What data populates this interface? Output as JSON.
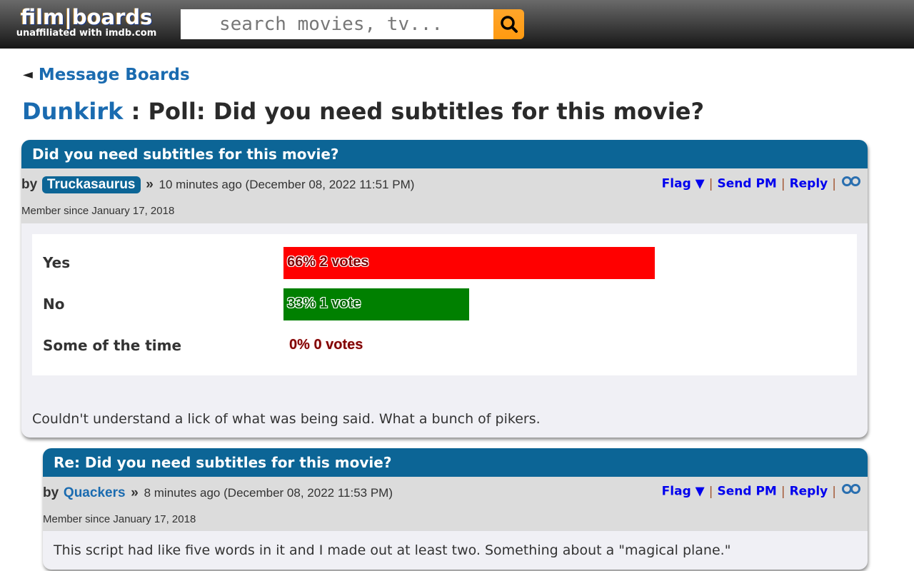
{
  "header": {
    "logo_main": "film|boards",
    "logo_sub": "unaffiliated with imdb.com",
    "search_placeholder": "search movies, tv...",
    "search_icon": "magnifier-icon",
    "accent_color": "#ff9f1c"
  },
  "breadcrumb": {
    "arrow": "◄",
    "label": "Message Boards"
  },
  "page_title": {
    "board": "Dunkirk",
    "separator": " : ",
    "topic": "Poll: Did you need subtitles for this movie?"
  },
  "posts": [
    {
      "title": "Did you need subtitles for this movie?",
      "by": "by",
      "author": "Truckasaurus",
      "raquo": "»",
      "time_ago": "10 minutes ago",
      "timestamp": "(December 08, 2022 11:51 PM)",
      "member_since": "Member since January 17, 2018",
      "actions": {
        "flag": "Flag ▼",
        "send_pm": "Send PM",
        "reply": "Reply",
        "sep": "|"
      },
      "poll": {
        "options": [
          {
            "label": "Yes",
            "percent": 66,
            "votes_text": "66% 2 votes",
            "color": "#ff0000"
          },
          {
            "label": "No",
            "percent": 33,
            "votes_text": "33% 1 vote",
            "color": "#008000"
          },
          {
            "label": "Some of the time",
            "percent": 0,
            "votes_text": "0% 0 votes",
            "color": "#800000"
          }
        ]
      },
      "body": "Couldn't understand a lick of what was being said. What a bunch of pikers."
    },
    {
      "title": "Re: Did you need subtitles for this movie?",
      "by": "by",
      "author": "Quackers",
      "raquo": "»",
      "time_ago": "8 minutes ago",
      "timestamp": "(December 08, 2022 11:53 PM)",
      "member_since": "Member since January 17, 2018",
      "actions": {
        "flag": "Flag ▼",
        "send_pm": "Send PM",
        "reply": "Reply",
        "sep": "|"
      },
      "body": "This script had like five words in it and I made out at least two. Something about a \"magical plane.\""
    }
  ],
  "colors": {
    "post_header": "#0c6596",
    "link": "#1a6bb0",
    "action_link": "#0000ee"
  }
}
